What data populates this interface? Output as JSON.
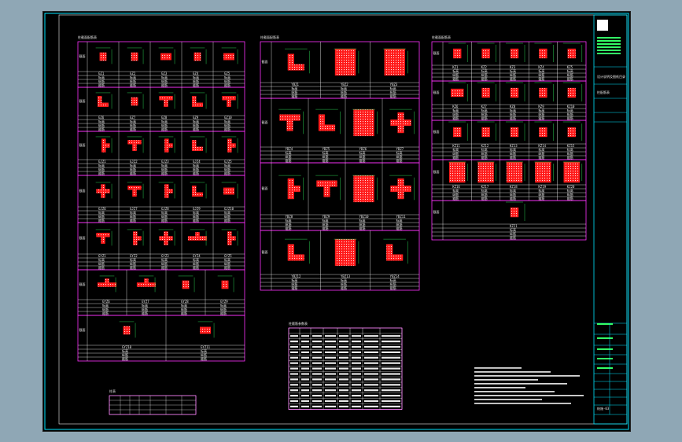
{
  "drawing": {
    "panel_titles": {
      "left": "柱截面配筋表",
      "middle": "柱截面配筋表",
      "right": "柱截面配筋表",
      "schedule": "柱箍筋参数表",
      "note_table": "柱表"
    },
    "left_panel": {
      "rows": [
        {
          "ids": [
            "GZ1",
            "GZ2",
            "GZ3",
            "GZ4",
            "GZ5"
          ]
        },
        {
          "ids": [
            "GZ6",
            "GZ7",
            "GZ8",
            "GZ9",
            "GZ10"
          ]
        },
        {
          "ids": [
            "GJZ1",
            "GJZ2",
            "GJZ3",
            "GJZ4",
            "GJZ5"
          ]
        },
        {
          "ids": [
            "GJZ6",
            "GJZ7",
            "GJZ8",
            "GJZ9",
            "GJZ10"
          ]
        },
        {
          "ids": [
            "GYZ1",
            "GYZ2",
            "GYZ3",
            "GYZ4",
            "GYZ5"
          ]
        },
        {
          "ids": [
            "GYZ6",
            "GYZ7",
            "GYZ8",
            "GYZ9"
          ]
        },
        {
          "ids": [
            "GYZ10",
            "GYZ11"
          ]
        }
      ]
    },
    "middle_panel": {
      "rows": [
        {
          "ids": [
            "YBZ1",
            "YBZ2",
            "YBZ3"
          ]
        },
        {
          "ids": [
            "YBZ4",
            "YBZ5",
            "YBZ6",
            "YBZ7"
          ]
        },
        {
          "ids": [
            "YBZ8",
            "YBZ9",
            "YBZ10",
            "YBZ11"
          ]
        },
        {
          "ids": [
            "YBZ12",
            "YBZ13",
            "YBZ14"
          ]
        }
      ]
    },
    "right_panel": {
      "rows": [
        {
          "ids": [
            "KZ1",
            "KZ2",
            "KZ3",
            "KZ4",
            "KZ5"
          ]
        },
        {
          "ids": [
            "KZ6",
            "KZ7",
            "KZ8",
            "KZ9",
            "KZ10"
          ]
        },
        {
          "ids": [
            "KZ11",
            "KZ12",
            "KZ13",
            "KZ14",
            "KZ15"
          ]
        },
        {
          "ids": [
            "KZ16",
            "KZ17",
            "KZ18",
            "KZ19",
            "KZ20"
          ]
        },
        {
          "ids": [
            "KZ21"
          ]
        }
      ]
    },
    "schedule_rows": 14,
    "title_block": {
      "top_note": "设计说明及图纸目录",
      "drawing_name": "柱配筋表",
      "drawing_no": "结施-03"
    },
    "colors": {
      "background": "#000000",
      "frame": "#00e5ff",
      "table_border": "#ff33ff",
      "hatch": "#ff1a1a",
      "dimension": "#33ff66",
      "text": "#e8e8e8"
    }
  }
}
